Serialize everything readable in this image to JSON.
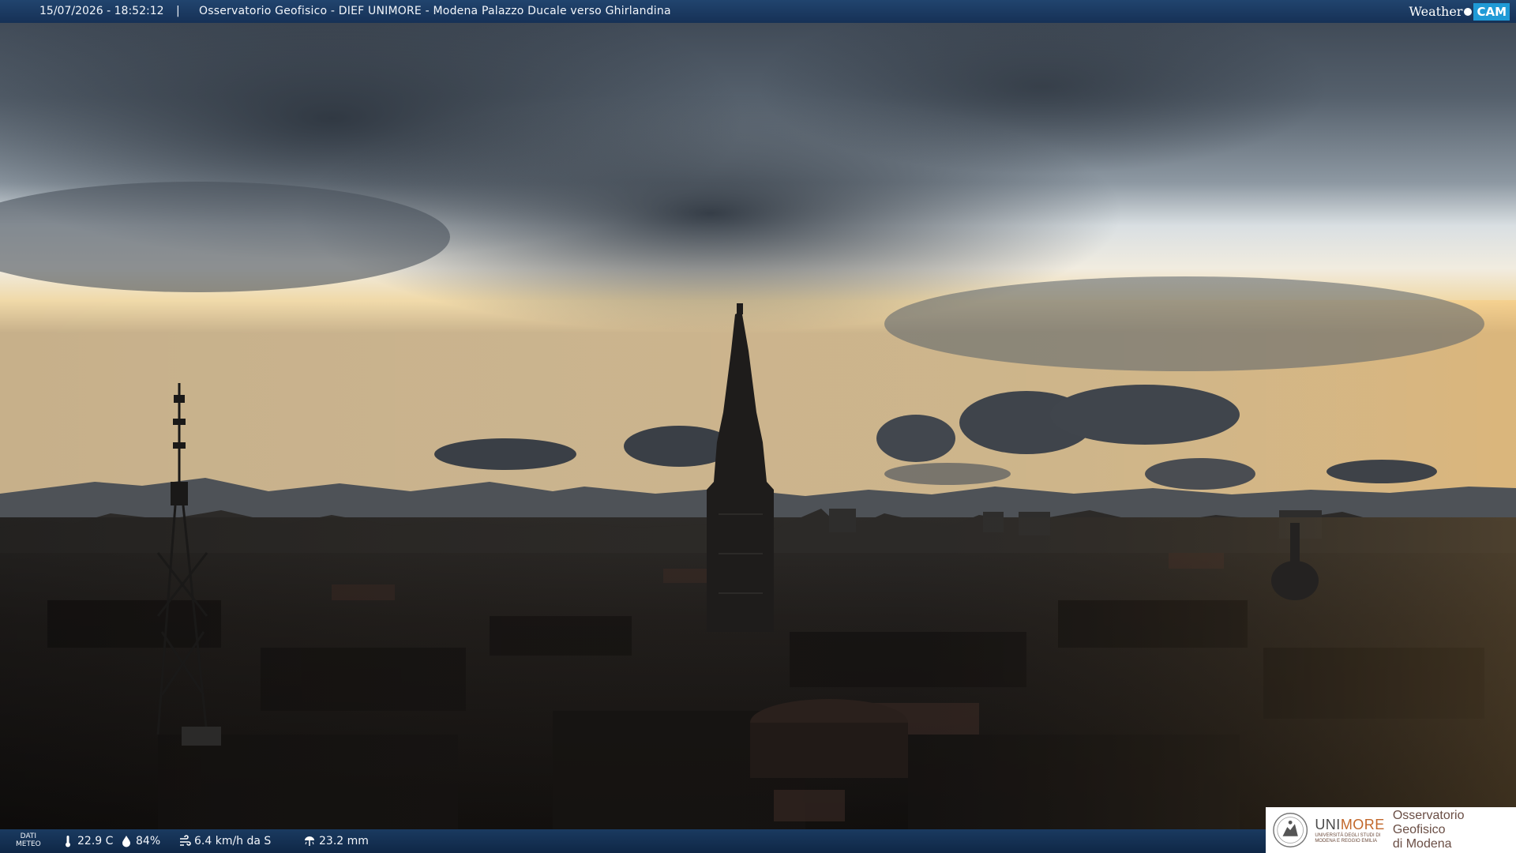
{
  "header": {
    "timestamp": "15/07/2026 - 18:52:12",
    "separator": "|",
    "title": "Osservatorio Geofisico - DIEF UNIMORE - Modena Palazzo Ducale verso Ghirlandina",
    "brand_weather": "Weather",
    "brand_cam": "CAM"
  },
  "footer": {
    "label_line1": "DATI",
    "label_line2": "METEO",
    "temperature": "22.9 C",
    "humidity": "84%",
    "wind": "6.4 km/h da S",
    "rain": "23.2 mm"
  },
  "logo": {
    "uni_prefix": "UNI",
    "uni_suffix": "MORE",
    "uni_small1": "UNIVERSITÀ DEGLI STUDI DI",
    "uni_small2": "MODENA E REGGIO EMILIA",
    "obs_line1": "Osservatorio Geofisico",
    "obs_line2": "di Modena"
  },
  "icons": {
    "temperature": "thermometer-icon",
    "humidity": "droplet-icon",
    "wind": "wind-icon",
    "rain": "rain-gauge-icon"
  },
  "colors": {
    "bar": "#163156",
    "brand_cam": "#1f9ad6",
    "unimore_accent": "#c2672a"
  }
}
